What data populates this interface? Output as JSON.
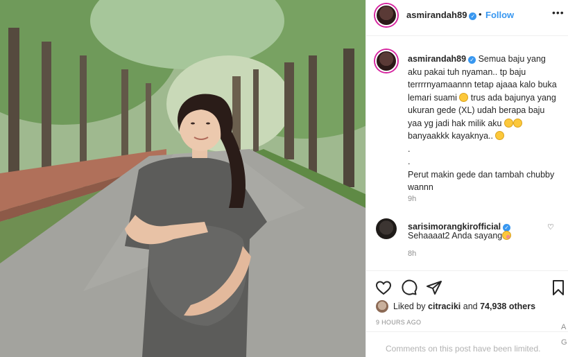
{
  "post": {
    "username": "asmirandah89",
    "follow_label": "Follow",
    "dot": "•",
    "more_label": "•••",
    "caption_line1": "Semua baju yang aku pakai tuh nyaman.. tp baju terrrrnyamaannn tetap ajaaa kalo buka lemari suami ",
    "caption_line2": " trus ada bajunya yang ukuran gede (XL) udah berapa baju yaa yg jadi hak milik aku ",
    "caption_line3": " banyaakkk kayaknya.. ",
    "caption_line4": "\n.\n.\nPerut makin gede dan tambah chubby wannn",
    "caption_time": "9h"
  },
  "comment": {
    "username": "sarisimorangkirofficial",
    "text": "Sehaaaat2 Anda sayang",
    "time": "8h"
  },
  "likes": {
    "prefix": "Liked by ",
    "user": "citraciki",
    "middle": " and ",
    "count": "74,938 others"
  },
  "time_ago": "9 HOURS AGO",
  "comments_limited": "Comments on this post have been limited.",
  "edge_chars": [
    "A",
    "G"
  ],
  "icons": {
    "heart": "heart-icon",
    "comment": "comment-icon",
    "share": "share-icon",
    "save": "bookmark-icon"
  },
  "colors": {
    "link": "#3897f0",
    "muted": "#8e8e8e",
    "text": "#262626"
  }
}
